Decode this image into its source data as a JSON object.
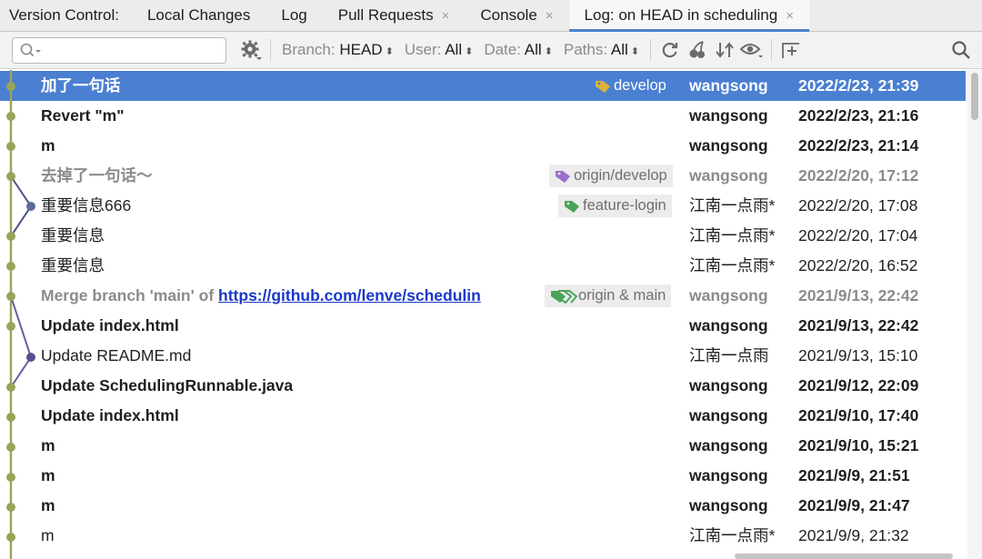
{
  "tabbar": {
    "label": "Version Control:",
    "tabs": [
      {
        "label": "Local Changes",
        "closable": false,
        "active": false
      },
      {
        "label": "Log",
        "closable": false,
        "active": false
      },
      {
        "label": "Pull Requests",
        "closable": true,
        "active": false
      },
      {
        "label": "Console",
        "closable": true,
        "active": false
      },
      {
        "label": "Log: on HEAD in scheduling",
        "closable": true,
        "active": true
      }
    ],
    "close_glyph": "×"
  },
  "toolbar": {
    "search": {
      "placeholder": "",
      "value": "",
      "icon": "search-icon"
    },
    "settings_icon": "gear-icon",
    "filters": [
      {
        "name": "Branch",
        "value": "HEAD"
      },
      {
        "name": "User",
        "value": "All"
      },
      {
        "name": "Date",
        "value": "All"
      },
      {
        "name": "Paths",
        "value": "All"
      }
    ],
    "filter_arrow": "⬍",
    "actions": [
      "refresh-icon",
      "cherry-pick-icon",
      "sort-icon",
      "eye-icon",
      "new-tab-icon"
    ],
    "find_icon": "search-icon",
    "colors": {
      "accent": "#4a7fd1",
      "tab_underline": "#4a83c8"
    }
  },
  "commits": [
    {
      "subject": "加了一句话",
      "tag": "develop",
      "tag_color": "#e0b23a",
      "author": "wangsong",
      "date": "2022/2/23, 21:39",
      "style": "bold",
      "selected": true
    },
    {
      "subject": "Revert \"m\"",
      "author": "wangsong",
      "date": "2022/2/23, 21:16",
      "style": "bold"
    },
    {
      "subject": "m",
      "author": "wangsong",
      "date": "2022/2/23, 21:14",
      "style": "bold"
    },
    {
      "subject": "去掉了一句话～",
      "tag": "origin/develop",
      "tag_color": "#9b6ec9",
      "author": "wangsong",
      "date": "2022/2/20, 17:12",
      "style": "gray"
    },
    {
      "subject": "重要信息666",
      "tag": "feature-login",
      "tag_color": "#4aa35a",
      "author": "江南一点雨*",
      "date": "2022/2/20, 17:08",
      "style": "normal"
    },
    {
      "subject": "重要信息",
      "author": "江南一点雨*",
      "date": "2022/2/20, 17:04",
      "style": "normal"
    },
    {
      "subject": "重要信息",
      "author": "江南一点雨*",
      "date": "2022/2/20, 16:52",
      "style": "normal"
    },
    {
      "subject": "Merge branch 'main' of ",
      "link": "https://github.com/lenve/schedulin",
      "tag": "origin & main",
      "tag_color": "#4aa35a",
      "author": "wangsong",
      "date": "2021/9/13, 22:42",
      "style": "gray"
    },
    {
      "subject": "Update index.html",
      "author": "wangsong",
      "date": "2021/9/13, 22:42",
      "style": "bold"
    },
    {
      "subject": "Update README.md",
      "author": "江南一点雨",
      "date": "2021/9/13, 15:10",
      "style": "normal"
    },
    {
      "subject": "Update SchedulingRunnable.java",
      "author": "wangsong",
      "date": "2021/9/12, 22:09",
      "style": "bold"
    },
    {
      "subject": "Update index.html",
      "author": "wangsong",
      "date": "2021/9/10, 17:40",
      "style": "bold"
    },
    {
      "subject": "m",
      "author": "wangsong",
      "date": "2021/9/10, 15:21",
      "style": "bold"
    },
    {
      "subject": "m",
      "author": "wangsong",
      "date": "2021/9/9, 21:51",
      "style": "bold"
    },
    {
      "subject": "m",
      "author": "wangsong",
      "date": "2021/9/9, 21:47",
      "style": "bold"
    },
    {
      "subject": "m",
      "author": "江南一点雨*",
      "date": "2021/9/9, 21:32",
      "style": "normal"
    }
  ],
  "graph_colors": {
    "main": "#9aa35a",
    "branch": "#4e4f8a",
    "branch_dot": "#5a6a9a",
    "merge": "#6a5aa0"
  }
}
